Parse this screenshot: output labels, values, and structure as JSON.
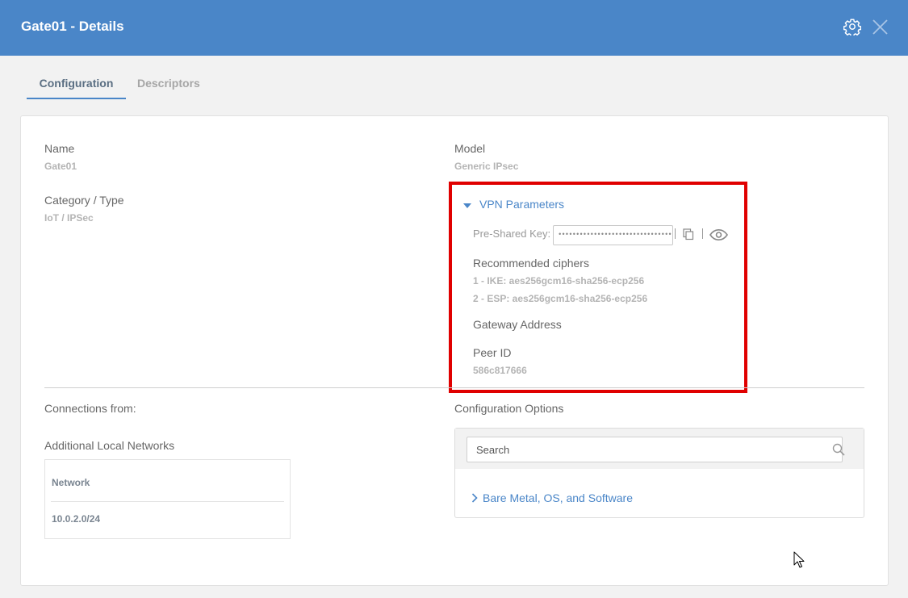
{
  "header": {
    "title": "Gate01 - Details",
    "settings_icon": "gear-icon",
    "close_icon": "close-icon"
  },
  "tabs": [
    {
      "label": "Configuration",
      "active": true
    },
    {
      "label": "Descriptors",
      "active": false
    }
  ],
  "fields": {
    "name": {
      "label": "Name",
      "value": "Gate01"
    },
    "model": {
      "label": "Model",
      "value": "Generic IPsec"
    },
    "category": {
      "label": "Category / Type",
      "value": "IoT / IPSec"
    }
  },
  "vpn": {
    "toggle_label": "VPN Parameters",
    "psk_label": "Pre-Shared Key:",
    "psk_value": "••••••••••••••••••••••••••••••••",
    "copy_icon": "copy-icon",
    "show_icon": "eye-icon",
    "ciphers_label": "Recommended ciphers",
    "ciphers": [
      "1 - IKE: aes256gcm16-sha256-ecp256",
      "2 - ESP: aes256gcm16-sha256-ecp256"
    ],
    "gateway_label": "Gateway Address",
    "peer_label": "Peer ID",
    "peer_value": "586c817666",
    "highlight_color": "#e00000"
  },
  "connections": {
    "label": "Connections from:",
    "networks_label": "Additional Local Networks",
    "table": {
      "header": "Network",
      "rows": [
        "10.0.2.0/24"
      ]
    }
  },
  "config_options": {
    "label": "Configuration Options",
    "search_placeholder": "Search",
    "items": [
      "Bare Metal, OS, and Software"
    ]
  },
  "colors": {
    "header_bg": "#4a86c8",
    "accent": "#4a86c8"
  }
}
